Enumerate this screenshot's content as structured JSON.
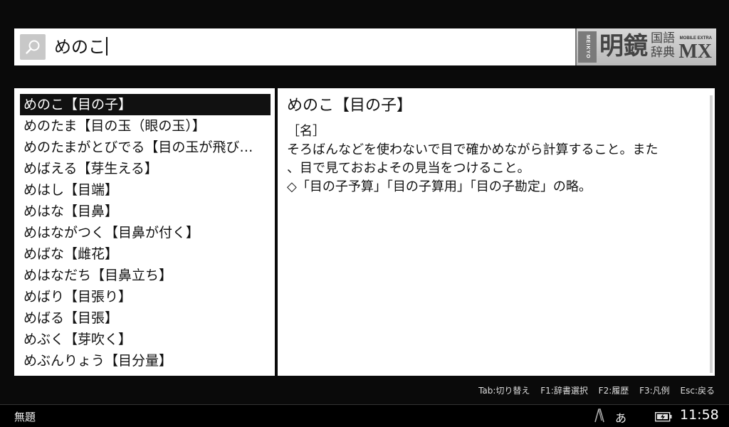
{
  "search": {
    "value": "めのこ"
  },
  "logo": {
    "publisher": "MEIKYO",
    "name": "明鏡",
    "subtitle": "国語辞典",
    "edition_small": "MOBILE EXTRA",
    "edition": "MX"
  },
  "word_list": {
    "items": [
      {
        "label": "めのこ【目の子】",
        "selected": true
      },
      {
        "label": "めのたま【目の玉（眼の玉）】",
        "selected": false
      },
      {
        "label": "めのたまがとびでる【目の玉が飛び…",
        "selected": false
      },
      {
        "label": "めばえる【芽生える】",
        "selected": false
      },
      {
        "label": "めはし【目端】",
        "selected": false
      },
      {
        "label": "めはな【目鼻】",
        "selected": false
      },
      {
        "label": "めはながつく【目鼻が付く】",
        "selected": false
      },
      {
        "label": "めばな【雌花】",
        "selected": false
      },
      {
        "label": "めはなだち【目鼻立ち】",
        "selected": false
      },
      {
        "label": "めばり【目張り】",
        "selected": false
      },
      {
        "label": "めばる【目張】",
        "selected": false
      },
      {
        "label": "めぶく【芽吹く】",
        "selected": false
      },
      {
        "label": "めぶんりょう【目分量】",
        "selected": false
      }
    ]
  },
  "definition": {
    "heading": "めのこ【目の子】",
    "lines": [
      "［名］",
      "そろばんなどを使わないで目で確かめながら計算すること。また",
      "、目で見ておおよその見当をつけること。",
      "◇「目の子予算」「目の子算用」「目の子勘定」の略。"
    ]
  },
  "key_hints": [
    "Tab:切り替え",
    "F1:辞書選択",
    "F2:履歴",
    "F3:凡例",
    "Esc:戻る"
  ],
  "status_bar": {
    "title": "無題",
    "ime_mode": "あ",
    "time": "11:58",
    "icons": [
      "pen-icon",
      "battery-icon"
    ]
  }
}
